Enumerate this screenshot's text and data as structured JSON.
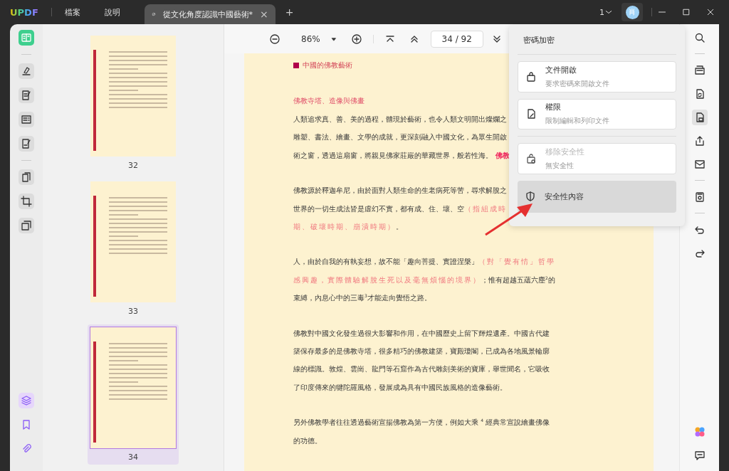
{
  "title_bar": {
    "logo": "UPDF",
    "menus": [
      "檔案",
      "說明"
    ],
    "tab": {
      "title": "從文化角度認識中國藝術*",
      "close": "×"
    },
    "new_tab": "+",
    "page_count": "1",
    "avatar": "肖"
  },
  "left_tools": [
    {
      "kind": "reader",
      "selected": true
    },
    {
      "kind": "highlight",
      "selected": false
    },
    {
      "kind": "edit",
      "selected": false
    },
    {
      "kind": "form",
      "selected": false
    },
    {
      "kind": "sign",
      "selected": false
    },
    {
      "kind": "pages",
      "selected": false
    },
    {
      "kind": "crop",
      "selected": false
    },
    {
      "kind": "overlay",
      "selected": false
    }
  ],
  "left_bottom": [
    {
      "kind": "layers",
      "selected": true
    },
    {
      "kind": "bookmark",
      "selected": false
    },
    {
      "kind": "attachment",
      "selected": false
    }
  ],
  "thumbnails": [
    {
      "label": "32",
      "selected": false
    },
    {
      "label": "33",
      "selected": false
    },
    {
      "label": "34",
      "selected": true
    }
  ],
  "toolbar": {
    "zoom": "86%",
    "page_field": "34 / 92"
  },
  "page": {
    "section": "中國的佛教藝術",
    "heading": "佛教寺塔、造像與佛畫",
    "paragraphs": [
      [
        [
          {
            "t": "人類追求真、善、美的過程，體現於藝術，也令人類文明開出燦爛之",
            "kind": "normal"
          }
        ],
        [
          {
            "t": "雕塑、書法、繪畫、文學的成就，更深刻融入中國文化，為眾生開啟",
            "kind": "normal"
          }
        ],
        [
          {
            "t": "術之窗，透過這扇窗，將親見佛家莊嚴的華藏世界，般若性海。",
            "kind": "normal"
          },
          {
            "t": "佛教",
            "kind": "tag"
          }
        ]
      ],
      [
        [
          {
            "t": "佛教源於釋迦牟尼，由於面對人類生命的生老病死等苦，尋求解脫之",
            "kind": "normal"
          }
        ],
        [
          {
            "t": "世界的一切生成法皆是虛幻不實，都有成、住、壞、空",
            "kind": "normal"
          },
          {
            "t": "（指組成時",
            "kind": "accent"
          }
        ],
        [
          {
            "t": "期、破壞時期、崩潰時期）",
            "kind": "accent"
          },
          {
            "t": "。",
            "kind": "normal"
          }
        ]
      ],
      [
        [
          {
            "t": "人，由於自我的有執妄想，故不能「趣向菩提、實證涅槃」",
            "kind": "normal"
          },
          {
            "t": "（對「覺有情」哲學",
            "kind": "accent"
          }
        ],
        [
          {
            "t": "感興趣，實際體驗解脫生死以及毫無煩惱的境界）",
            "kind": "accent"
          },
          {
            "t": "；惟有超越五蘊六塵$^{2}$的",
            "kind": "normal"
          }
        ],
        [
          {
            "t": "束縛，內息心中的三毒$^{3}$才能走向覺悟之路。",
            "kind": "normal"
          }
        ]
      ],
      [
        [
          {
            "t": "佛教對中國文化發生過很大影響和作用，在中國歷史上留下輝煌遺產。中國古代建",
            "kind": "normal"
          }
        ],
        [
          {
            "t": "築保存最多的是佛教寺塔，很多精巧的佛教建築，寶殿瓊閣，已成為各地風景輪廓",
            "kind": "normal"
          }
        ],
        [
          {
            "t": "線的標識。敦煌、雲崗、龍門等石窟作為古代雕刻美術的寶庫，舉世聞名，它吸收",
            "kind": "normal"
          }
        ],
        [
          {
            "t": "了印度傳來的犍陀羅風格，發展成為具有中國民族風格的造像藝術。",
            "kind": "normal"
          }
        ]
      ],
      [
        [
          {
            "t": "另外佛教學者往往透過藝術宣揚佛教為第一方便，例如大乘 $^{4}$ 經典常宣說繪畫佛像",
            "kind": "normal"
          }
        ],
        [
          {
            "t": "的功德。",
            "kind": "normal"
          }
        ]
      ]
    ]
  },
  "popup": {
    "title": "密碼加密",
    "options": [
      {
        "kind": "card",
        "title": "文件開啟",
        "subtitle": "要求密碼來開啟文件",
        "disabled": false,
        "selected": false
      },
      {
        "kind": "card",
        "title": "權限",
        "subtitle": "限制編輯和列印文件",
        "disabled": false,
        "selected": false
      },
      {
        "kind": "card",
        "title": "移除安全性",
        "subtitle": "無安全性",
        "disabled": true,
        "selected": false
      },
      {
        "kind": "plain",
        "title": "安全性內容",
        "disabled": false,
        "selected": true
      }
    ]
  },
  "right_tools": [
    {
      "kind": "search",
      "selected": false
    },
    {
      "kind": "ocr",
      "selected": false
    },
    {
      "kind": "convert",
      "selected": false
    },
    {
      "kind": "protect",
      "selected": true
    },
    {
      "kind": "share",
      "selected": false
    },
    {
      "kind": "mail",
      "selected": false
    },
    {
      "kind": "save",
      "selected": false
    },
    {
      "kind": "undo",
      "selected": false
    },
    {
      "kind": "redo",
      "selected": false
    }
  ]
}
